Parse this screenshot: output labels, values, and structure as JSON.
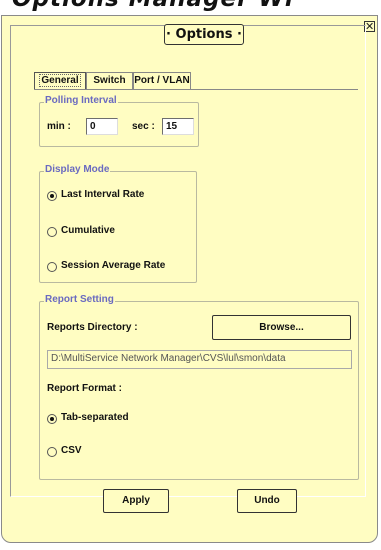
{
  "header_text": "Options Manager Wi",
  "window": {
    "close_glyph": "✕",
    "title": "· Options ·"
  },
  "tabs": [
    {
      "label": "General",
      "active": true
    },
    {
      "label": "Switch",
      "active": false
    },
    {
      "label": "Port / VLAN",
      "active": false
    }
  ],
  "polling": {
    "legend": "Polling Interval",
    "min_label": "min :",
    "min_value": "0",
    "sec_label": "sec :",
    "sec_value": "15"
  },
  "display_mode": {
    "legend": "Display Mode",
    "options": [
      {
        "label": "Last Interval Rate",
        "selected": true
      },
      {
        "label": "Cumulative",
        "selected": false
      },
      {
        "label": "Session Average Rate",
        "selected": false
      }
    ]
  },
  "report": {
    "legend": "Report Setting",
    "directory_label": "Reports Directory :",
    "browse_label": "Browse...",
    "path_value": "D:\\MultiService Network Manager\\CVS\\lul\\smon\\data",
    "format_label": "Report Format :",
    "formats": [
      {
        "label": "Tab-separated",
        "selected": true
      },
      {
        "label": "CSV",
        "selected": false
      }
    ]
  },
  "footer": {
    "apply_label": "Apply",
    "undo_label": "Undo"
  },
  "colors": {
    "panel_bg": "#fffdc2",
    "legend_text": "#6a6ac0"
  }
}
